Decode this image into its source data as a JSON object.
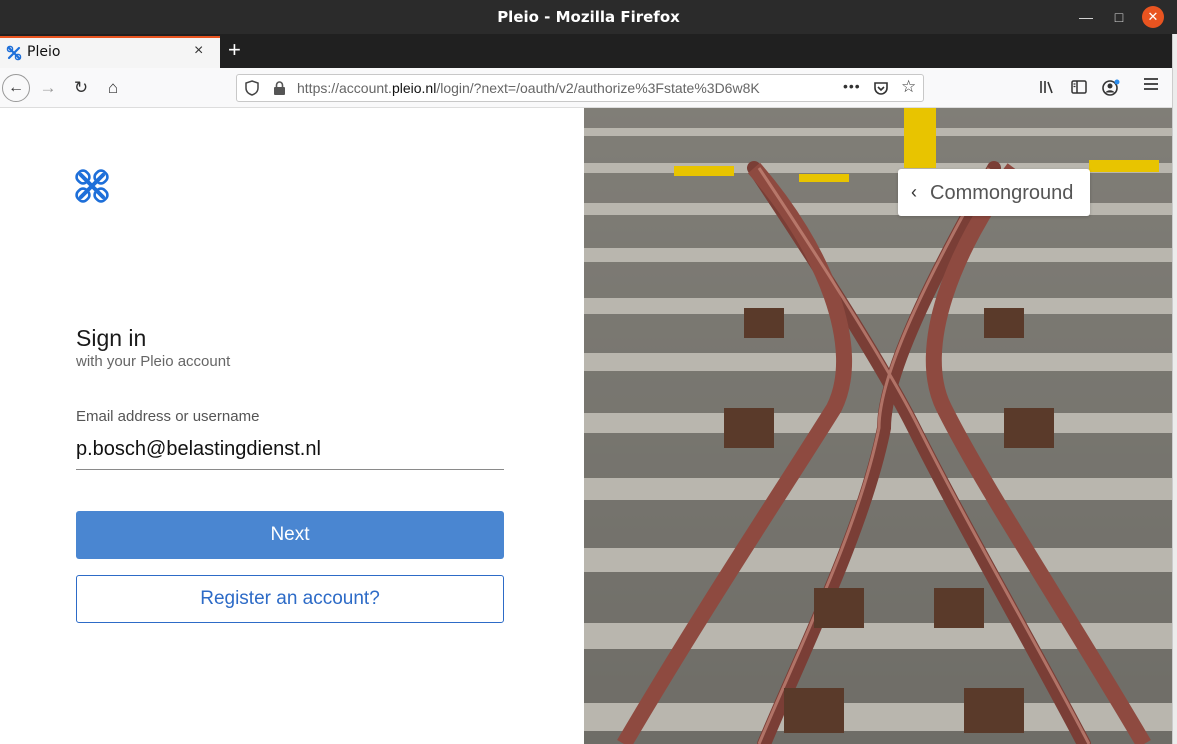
{
  "window": {
    "title": "Pleio - Mozilla Firefox"
  },
  "tabs": [
    {
      "label": "Pleio",
      "close": "×"
    }
  ],
  "newtab": "+",
  "nav": {
    "back": "←",
    "forward": "→",
    "reload": "↻",
    "home": "⌂",
    "url_prefix": "https://account.",
    "url_host": "pleio.nl",
    "url_path": "/login/?next=/oauth/v2/authorize%3Fstate%3D6w8K",
    "more": "•••",
    "star": "☆"
  },
  "page": {
    "title": "Sign in",
    "subtitle": "with your Pleio account",
    "email_label": "Email address or username",
    "email_value": "p.bosch@belastingdienst.nl",
    "next_button": "Next",
    "register_button": "Register an account?",
    "community_label": "Commonground"
  },
  "colors": {
    "primary": "#4a86d1",
    "accent": "#e95420",
    "logo": "#1e6fd9"
  }
}
